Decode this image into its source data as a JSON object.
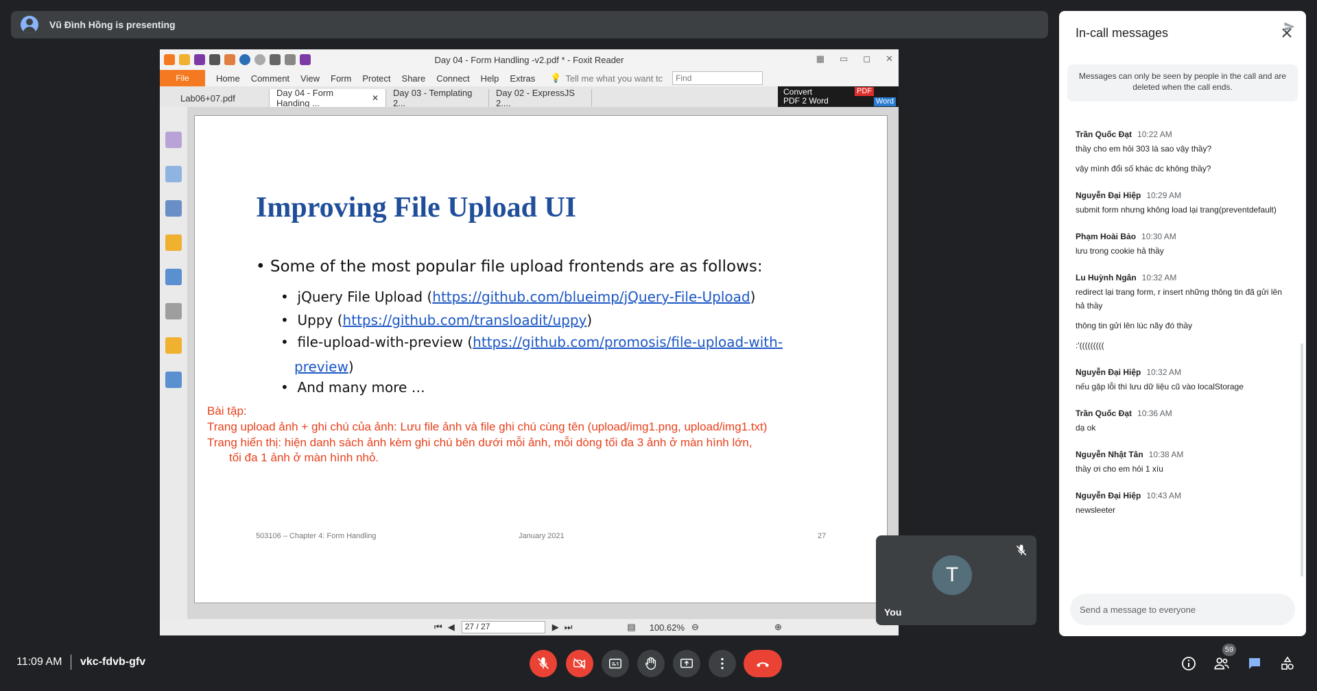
{
  "presenter": {
    "text": "Vũ Đình Hồng is presenting"
  },
  "foxit": {
    "window_title": "Day 04 - Form Handling -v2.pdf * - Foxit Reader",
    "menu": {
      "file": "File",
      "items": [
        "Home",
        "Comment",
        "View",
        "Form",
        "Protect",
        "Share",
        "Connect",
        "Help",
        "Extras"
      ],
      "tell_me": "Tell me what you want tc",
      "find_placeholder": "Find"
    },
    "tabs": [
      "Lab06+07.pdf",
      "Day 04 - Form Handing ...",
      "Day 03 - Templating 2...",
      "Day 02 - ExpressJS 2...."
    ],
    "convert": {
      "line1": "Convert",
      "line2": "PDF 2 Word",
      "pdf": "PDF",
      "word": "Word"
    },
    "status": {
      "page": "27 / 27",
      "zoom": "100.62%"
    }
  },
  "slide": {
    "title": "Improving File Upload UI",
    "intro": "• Some of the most popular file upload frontends are as follows:",
    "items": [
      {
        "bullet": "•",
        "name": "jQuery File Upload (",
        "link": "https://github.com/blueimp/jQuery-File-Upload",
        "tail": ")"
      },
      {
        "bullet": "•",
        "name": "Uppy (",
        "link": "https://github.com/transloadit/uppy",
        "tail": ")"
      },
      {
        "bullet": "•",
        "name": "file-upload-with-preview (",
        "link": "https://github.com/promosis/file-upload-with-",
        "link2": "preview",
        "tail": ")"
      },
      {
        "bullet": "•",
        "name": "And many more …"
      }
    ],
    "exercise": [
      "Bài tập:",
      "Trang upload ảnh + ghi chú của ảnh: Lưu file ảnh và file ghi chú cùng tên (upload/img1.png, upload/img1.txt)",
      "Trang hiển thị: hiện danh sách ảnh kèm ghi chú bên dưới mỗi ảnh, mỗi dòng tối đa 3 ảnh ở màn hình lớn,",
      "tối đa 1 ảnh ở màn hình nhỏ."
    ],
    "footer": {
      "left": "503106 – Chapter 4: Form Handling",
      "center": "January 2021",
      "right": "27"
    }
  },
  "self_tile": {
    "initial": "T",
    "name": "You"
  },
  "chat": {
    "title": "In-call messages",
    "notice": "Messages can only be seen by people in the call and are deleted when the call ends.",
    "messages": [
      {
        "sender": "Trần Quốc Đạt",
        "time": "10:22 AM",
        "lines": [
          "thầy cho em hỏi 303 là sao vậy thầy?",
          "vậy mình đổi số khác dc không thầy?"
        ]
      },
      {
        "sender": "Nguyễn Đại Hiệp",
        "time": "10:29 AM",
        "lines": [
          "submit form nhưng không load lại trang(preventdefault)"
        ]
      },
      {
        "sender": "Phạm Hoài Bảo",
        "time": "10:30 AM",
        "lines": [
          "lưu trong cookie hả thầy"
        ]
      },
      {
        "sender": "Lu Huỳnh Ngân",
        "time": "10:32 AM",
        "lines": [
          "redirect lại trang form, r insert những thông tin đã gửi lên hả thầy",
          "thông tin gửi lên lúc nãy đó thầy",
          ":'((((((((("
        ]
      },
      {
        "sender": "Nguyễn Đại Hiệp",
        "time": "10:32 AM",
        "lines": [
          "nếu gặp lỗi thì lưu dữ liệu cũ vào localStorage"
        ]
      },
      {
        "sender": "Trần Quốc Đạt",
        "time": "10:36 AM",
        "lines": [
          "dạ ok"
        ]
      },
      {
        "sender": "Nguyễn Nhật Tân",
        "time": "10:38 AM",
        "lines": [
          "thầy ơi cho em hỏi 1 xíu"
        ]
      },
      {
        "sender": "Nguyễn Đại Hiệp",
        "time": "10:43 AM",
        "lines": [
          "newsleeter"
        ]
      }
    ],
    "input_placeholder": "Send a message to everyone"
  },
  "bottom": {
    "time": "11:09 AM",
    "meeting_code": "vkc-fdvb-gfv",
    "participant_count": "59"
  },
  "colors": {
    "end_call": "#ea4335",
    "slide_title": "#1f4e9a",
    "exercise": "#e8401c",
    "link": "#1a56c4"
  }
}
